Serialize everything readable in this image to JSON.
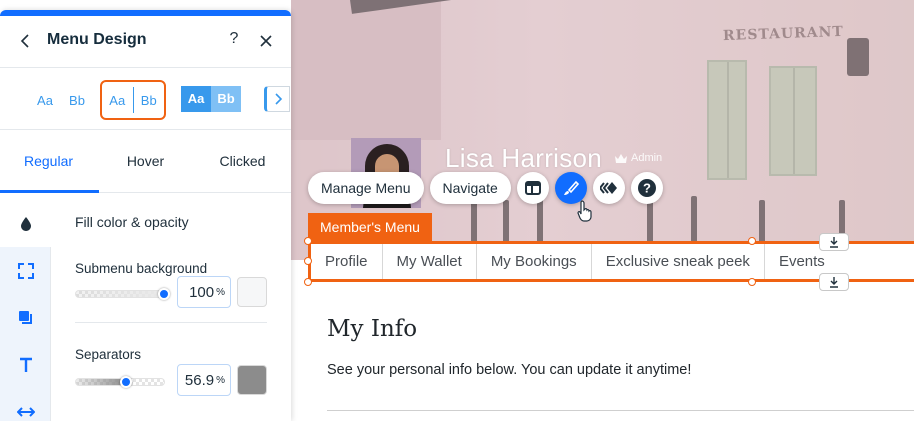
{
  "panel": {
    "title": "Menu Design",
    "presets": [
      {
        "a": "Aa",
        "b": "Bb"
      },
      {
        "a": "Aa",
        "b": "Bb"
      },
      {
        "a": "Aa",
        "b": "Bb"
      }
    ],
    "tabs": [
      {
        "label": "Regular",
        "active": true
      },
      {
        "label": "Hover",
        "active": false
      },
      {
        "label": "Clicked",
        "active": false
      }
    ],
    "rail_icons": [
      "fill-drop-icon",
      "corners-icon",
      "shadow-icon",
      "text-icon",
      "spacing-icon"
    ],
    "section_title": "Fill color & opacity",
    "submenu_background": {
      "label": "Submenu background",
      "value": "100",
      "unit": "%",
      "level": 1.0,
      "color": "#f6f7f8"
    },
    "separators": {
      "label": "Separators",
      "value": "56.9",
      "unit": "%",
      "level": 0.569,
      "color": "#8c8c8c"
    }
  },
  "site": {
    "hero_sign": "RESTAURANT",
    "member_name": "Lisa Harrison",
    "admin_label": "Admin",
    "toolbar": {
      "manage_menu": "Manage Menu",
      "navigate": "Navigate"
    },
    "menu_tag": "Member's Menu",
    "menu_items": [
      "Profile",
      "My Wallet",
      "My Bookings",
      "Exclusive sneak peek",
      "Events"
    ],
    "page_title": "My Info",
    "page_text": "See your personal info below. You can update it anytime!"
  },
  "colors": {
    "accent": "#116dff",
    "selection": "#f06212",
    "preset_blue": "#3899ec"
  }
}
